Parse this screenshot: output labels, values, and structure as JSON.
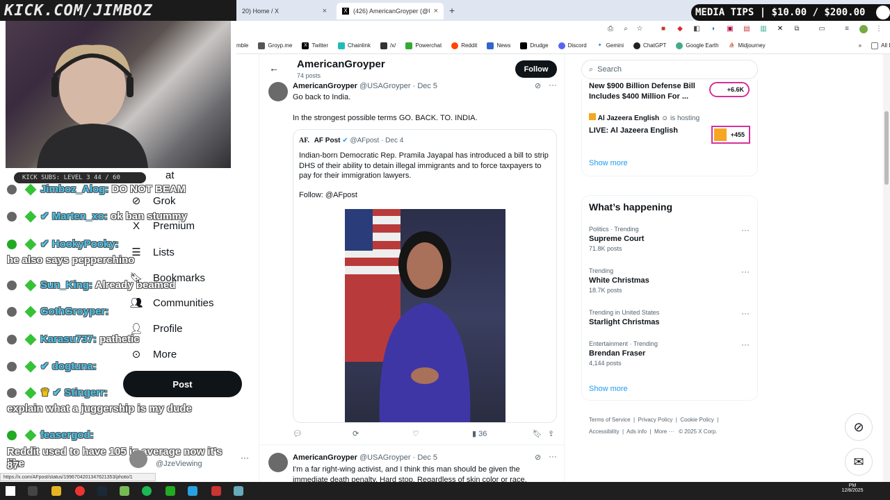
{
  "overlay": {
    "title": "KICK.COM/JIMBOZ",
    "media_tips": "MEDIA TIPS | $10.00 / $200.00",
    "kick_subs": "KICK SUBS: LEVEL 3 44 / 60"
  },
  "browser": {
    "tabs": [
      {
        "label": "20) Home / X"
      },
      {
        "label": "(426) AmericanGroyper (@USA..."
      }
    ],
    "bookmarks": [
      "mble",
      "Groyp.me",
      "Twitter",
      "Chainlink",
      "/x/",
      "Powerchat",
      "Reddit",
      "News",
      "Drudge",
      "Discord",
      "Gemini",
      "ChatGPT",
      "Google Earth",
      "Midjourney"
    ],
    "all_bookmarks": "All Bookmarks",
    "status_url": "https://x.com/AFpost/status/1996704201347621353/photo/1"
  },
  "chat": [
    {
      "user": "Jimboz_Alog:",
      "text": "DO NOT BEAM"
    },
    {
      "user": "Marten_xo:",
      "text": "ok ban stummy"
    },
    {
      "user": "HookyPooky:",
      "text": ""
    },
    {
      "user": "",
      "text": "he also says pepperchino"
    },
    {
      "user": "Sun_King:",
      "text": "Already beamed"
    },
    {
      "user": "GothGroyper:",
      "text": ""
    },
    {
      "user": "Karasu737:",
      "text": "pathetic"
    },
    {
      "user": "dogtuna:",
      "text": ""
    },
    {
      "user": "Stingerr:",
      "text": ""
    },
    {
      "user": "",
      "text": "explain what a juggership is my dude"
    },
    {
      "user": "feasergod:",
      "text": ""
    },
    {
      "user": "",
      "text": "Reddit used to have 105 iq average now it's like"
    },
    {
      "user": "",
      "text": "87"
    }
  ],
  "nav": {
    "items": [
      "at",
      "Grok",
      "Premium",
      "Lists",
      "Bookmarks",
      "Communities",
      "Profile",
      "More"
    ],
    "post_label": "Post",
    "account_handle": "@JzeViewing"
  },
  "profile": {
    "name": "AmericanGroyper",
    "posts": "74 posts",
    "follow": "Follow"
  },
  "tweet1": {
    "name": "AmericanGroyper",
    "handle": "@USAGroyper",
    "date": "· Dec 5",
    "line1": "Go back to India.",
    "line2": "In the strongest possible terms GO. BACK. TO. INDIA.",
    "quote": {
      "logo": "AF.",
      "name": "AF Post",
      "handle": "@AFpost",
      "date": "· Dec 4",
      "text": "Indian-born Democratic Rep. Pramila Jayapal has introduced a bill to strip DHS of their ability to detain illegal immigrants and to force taxpayers to pay for their immigration lawyers.",
      "follow": "Follow: @AFpost"
    },
    "views": "36"
  },
  "tweet2": {
    "name": "AmericanGroyper",
    "handle": "@USAGroyper",
    "date": "· Dec 5",
    "text": "I'm a far right-wing activist, and I think this man should be given the immediate death penalty. Hard stop. Regardless of skin color or race."
  },
  "right": {
    "search_placeholder": "Search",
    "news1": {
      "title": "New $900 Billion Defense Bill Includes $400 Million For ...",
      "badge": "+6.6K"
    },
    "live": {
      "host": "Al Jazeera English",
      "hosting": "is hosting",
      "title": "LIVE: Al Jazeera English",
      "badge": "+455"
    },
    "show_more": "Show more",
    "whats_happening": "What’s happening",
    "trends": [
      {
        "cat": "Politics · Trending",
        "name": "Supreme Court",
        "posts": "71.8K posts"
      },
      {
        "cat": "Trending",
        "name": "White Christmas",
        "posts": "18.7K posts"
      },
      {
        "cat": "Trending in United States",
        "name": "Starlight Christmas",
        "posts": ""
      },
      {
        "cat": "Entertainment · Trending",
        "name": "Brendan Fraser",
        "posts": "4,144 posts"
      }
    ],
    "show_more2": "Show more",
    "footer": [
      "Terms of Service",
      "Privacy Policy",
      "Cookie Policy",
      "Accessibility",
      "Ads info",
      "More ···",
      "© 2025 X Corp."
    ]
  },
  "clock": {
    "time": "PM",
    "date": "12/8/2025"
  },
  "colors": {
    "x_black": "#0f1419",
    "kick_green": "#36c236",
    "chat_user": "#46c7f0",
    "accent_blue": "#1d9bf0"
  }
}
